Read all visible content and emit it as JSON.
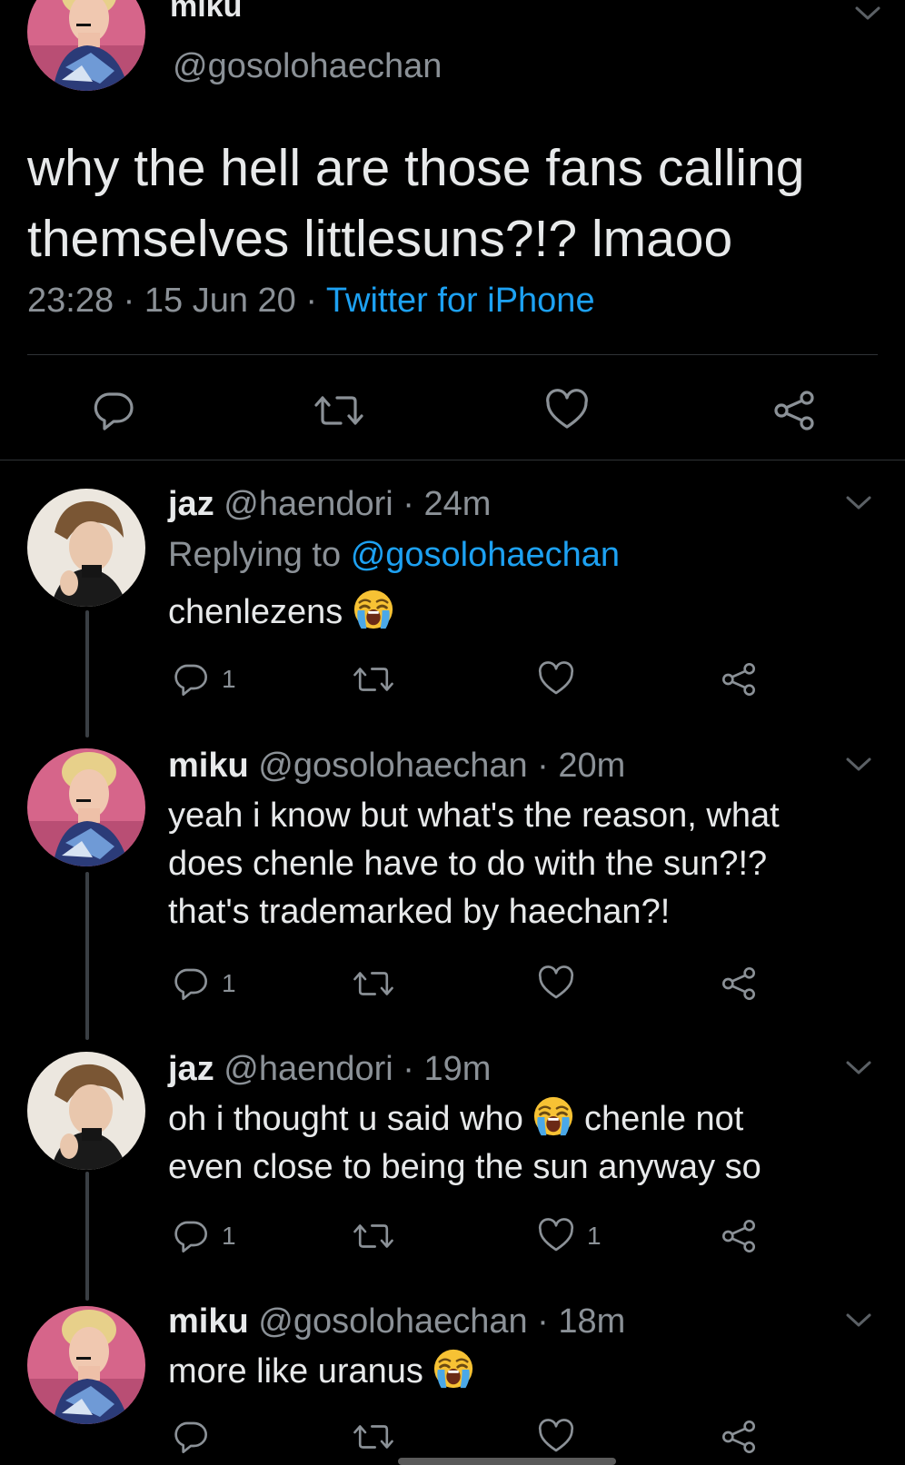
{
  "main_tweet": {
    "name": "miku",
    "handle": "@gosolohaechan",
    "text_line1": "why the hell are those fans calling",
    "text_line2": "themselves littlesuns?!? lmaoo",
    "time": "23:28",
    "date": "15 Jun 20",
    "source": "Twitter for iPhone",
    "sep": "·"
  },
  "replies": [
    {
      "name": "jaz",
      "handle": "@haendori",
      "time": "24m",
      "replying_label": "Replying to",
      "replying_handle": "@gosolohaechan",
      "text": "chenlezens",
      "reply_count": "1",
      "like_count": ""
    },
    {
      "name": "miku",
      "handle": "@gosolohaechan",
      "time": "20m",
      "lines": [
        "yeah i know but what's the reason, what",
        "does chenle have to do with the sun?!?",
        "that's trademarked by haechan?!"
      ],
      "reply_count": "1",
      "like_count": ""
    },
    {
      "name": "jaz",
      "handle": "@haendori",
      "time": "19m",
      "line1_a": "oh i thought u said who",
      "line1_b": "chenle not",
      "line2": "even close to being the sun anyway so",
      "reply_count": "1",
      "like_count": "1"
    },
    {
      "name": "miku",
      "handle": "@gosolohaechan",
      "time": "18m",
      "text": "more like uranus",
      "reply_count": "",
      "like_count": ""
    }
  ],
  "icons": {
    "reply": "reply-icon",
    "retweet": "retweet-icon",
    "like": "heart-icon",
    "share": "share-icon",
    "menu": "chevron-down-icon",
    "emoji": "loudly-crying-face-emoji"
  },
  "colors": {
    "background": "#000000",
    "text": "#e7e9ea",
    "secondary": "#8b9197",
    "link": "#1da1f2"
  }
}
